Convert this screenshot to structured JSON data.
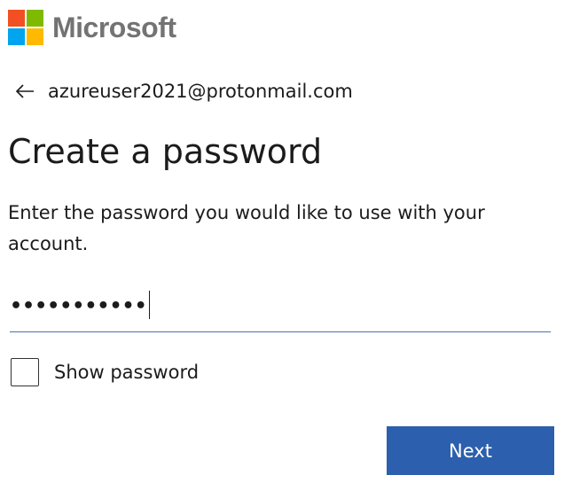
{
  "brand": {
    "name": "Microsoft",
    "colors": [
      "#f25022",
      "#7fba00",
      "#00a4ef",
      "#ffb900"
    ],
    "text_color": "#737373"
  },
  "identity": {
    "back_icon": "back-arrow-icon",
    "email": "azureuser2021@protonmail.com"
  },
  "title": "Create a password",
  "description": "Enter the password you would like to use with your account.",
  "password": {
    "masked_value": "•••••••••••"
  },
  "show_password": {
    "label": "Show password",
    "checked": false
  },
  "actions": {
    "next_label": "Next",
    "accent": "#2c5fad"
  }
}
